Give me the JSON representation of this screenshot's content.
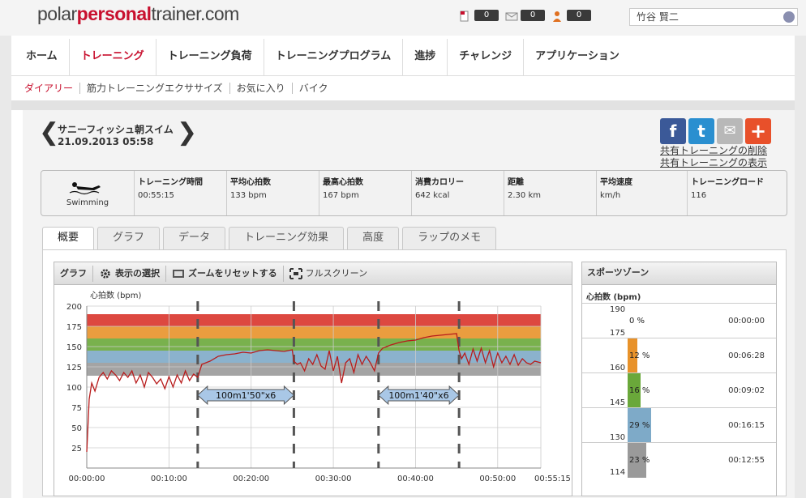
{
  "header": {
    "logo_prefix": "polar",
    "logo_red": "personal",
    "logo_suffix": "trainer.com",
    "counters": [
      {
        "icon": "document-icon",
        "value": "0"
      },
      {
        "icon": "mail-icon",
        "value": "0"
      },
      {
        "icon": "person-icon",
        "value": "0"
      }
    ],
    "user_name": "竹谷 賢二"
  },
  "main_nav": [
    {
      "label": "ホーム",
      "active": false
    },
    {
      "label": "トレーニング",
      "active": true
    },
    {
      "label": "トレーニング負荷",
      "active": false
    },
    {
      "label": "トレーニングプログラム",
      "active": false
    },
    {
      "label": "進捗",
      "active": false
    },
    {
      "label": "チャレンジ",
      "active": false
    },
    {
      "label": "アプリケーション",
      "active": false
    }
  ],
  "sub_nav": [
    {
      "label": "ダイアリー",
      "active": true
    },
    {
      "label": "筋力トレーニングエクササイズ",
      "active": false
    },
    {
      "label": "お気に入り",
      "active": false
    },
    {
      "label": "バイク",
      "active": false
    }
  ],
  "session": {
    "title": "サニーフィッシュ朝スイム",
    "datetime": "21.09.2013 05:58",
    "prev_icon": "chevron-left-icon",
    "next_icon": "chevron-right-icon"
  },
  "social": [
    {
      "icon": "facebook-icon",
      "glyph": "f",
      "color": "#3b5998"
    },
    {
      "icon": "twitter-icon",
      "glyph": "t",
      "color": "#2a8fd0"
    },
    {
      "icon": "mail-icon",
      "glyph": "✉",
      "color": "#b8b8b8"
    },
    {
      "icon": "plus-icon",
      "glyph": "+",
      "color": "#e8502a"
    }
  ],
  "share_links": [
    "共有トレーニングの削除",
    "共有トレーニングの表示"
  ],
  "stats": {
    "sport": "Swimming",
    "items": [
      {
        "label": "トレーニング時間",
        "value": "00:55:15"
      },
      {
        "label": "平均心拍数",
        "value": "133   bpm"
      },
      {
        "label": "最高心拍数",
        "value": "167   bpm"
      },
      {
        "label": "消費カロリー",
        "value": "642   kcal"
      },
      {
        "label": "距離",
        "value": "2.30   km"
      },
      {
        "label": "平均速度",
        "value": "km/h"
      },
      {
        "label": "トレーニングロード",
        "value": "116"
      }
    ]
  },
  "tabs": [
    {
      "label": "概要",
      "active": true
    },
    {
      "label": "グラフ",
      "active": false
    },
    {
      "label": "データ",
      "active": false
    },
    {
      "label": "トレーニング効果",
      "active": false
    },
    {
      "label": "高度",
      "active": false
    },
    {
      "label": "ラップのメモ",
      "active": false
    }
  ],
  "graph_toolbar": {
    "title": "グラフ",
    "select_label": "表示の選択",
    "reset_zoom_label": "ズームをリセットする",
    "fullscreen_label": "フルスクリーン"
  },
  "zones_panel": {
    "title": "スポーツゾーン",
    "unit_label": "心拍数 (bpm)",
    "zones": [
      {
        "upper": "190",
        "lower": "175",
        "percent": "0 %",
        "time": "00:00:00",
        "color": "#d9342b",
        "fraction": 0.0
      },
      {
        "upper": "",
        "lower": "160",
        "percent": "12 %",
        "time": "00:06:28",
        "color": "#e8922a",
        "fraction": 0.12
      },
      {
        "upper": "",
        "lower": "145",
        "percent": "16 %",
        "time": "00:09:02",
        "color": "#6aa83a",
        "fraction": 0.16
      },
      {
        "upper": "",
        "lower": "130",
        "percent": "29 %",
        "time": "00:16:15",
        "color": "#7eaac8",
        "fraction": 0.29
      },
      {
        "upper": "",
        "lower": "114",
        "percent": "23 %",
        "time": "00:12:55",
        "color": "#9a9a9a",
        "fraction": 0.23
      }
    ]
  },
  "chart_data": {
    "type": "line",
    "ylabel": "心拍数 (bpm)",
    "ylim": [
      0,
      200
    ],
    "yticks": [
      200,
      175,
      150,
      125,
      100,
      75,
      50,
      25
    ],
    "xticks": [
      "00:00:00",
      "00:10:00",
      "00:20:00",
      "00:30:00",
      "00:40:00",
      "00:50:00",
      "00:55:15"
    ],
    "xtick_minutes": [
      0,
      10,
      20,
      30,
      40,
      50,
      55.25
    ],
    "xlim_minutes": [
      0,
      55.25
    ],
    "grid": true,
    "zone_bands": [
      {
        "from": 175,
        "to": 190,
        "color": "#d9342b"
      },
      {
        "from": 160,
        "to": 175,
        "color": "#e8922a"
      },
      {
        "from": 145,
        "to": 160,
        "color": "#6aa83a"
      },
      {
        "from": 130,
        "to": 145,
        "color": "#7eaac8"
      },
      {
        "from": 114,
        "to": 130,
        "color": "#9a9a9a"
      }
    ],
    "interval_markers_minutes": [
      13.5,
      25.2,
      35.5,
      45.3
    ],
    "annotations": [
      {
        "text": "100m1'50\"x6",
        "from_min": 13.5,
        "to_min": 25.2,
        "y": 90
      },
      {
        "text": "100m1'40\"x6",
        "from_min": 35.5,
        "to_min": 45.3,
        "y": 90
      }
    ],
    "series": [
      {
        "color": "#b81c1c",
        "x": [
          0,
          0.3,
          0.6,
          1,
          1.5,
          2,
          2.5,
          3,
          3.5,
          4,
          4.5,
          5,
          5.5,
          6,
          6.5,
          7,
          7.5,
          8,
          8.5,
          9,
          9.5,
          10,
          10.5,
          11,
          11.5,
          12,
          12.5,
          13,
          13.5,
          14,
          15,
          16,
          17,
          18,
          19,
          20,
          21,
          22,
          23,
          24,
          25,
          25.2,
          25.6,
          26,
          26.5,
          27,
          27.5,
          28,
          28.5,
          29,
          29.5,
          30,
          30.5,
          31,
          31.5,
          32,
          32.5,
          33,
          33.5,
          34,
          34.5,
          35,
          35.5,
          36,
          37,
          38,
          39,
          40,
          41,
          42,
          43,
          44,
          45,
          45.3,
          45.6,
          46,
          46.5,
          47,
          47.5,
          48,
          48.5,
          49,
          49.5,
          50,
          50.5,
          51,
          51.5,
          52,
          52.5,
          53,
          53.5,
          54,
          54.5,
          55.25
        ],
        "values": [
          20,
          85,
          105,
          95,
          112,
          118,
          110,
          120,
          115,
          108,
          118,
          112,
          120,
          105,
          115,
          100,
          118,
          112,
          104,
          110,
          98,
          113,
          100,
          115,
          105,
          120,
          108,
          116,
          112,
          128,
          132,
          138,
          140,
          141,
          143,
          142,
          145,
          146,
          145,
          144,
          146,
          132,
          128,
          130,
          120,
          135,
          128,
          140,
          126,
          122,
          145,
          120,
          138,
          105,
          130,
          135,
          118,
          140,
          128,
          138,
          130,
          120,
          142,
          148,
          152,
          155,
          157,
          158,
          161,
          163,
          164,
          165,
          166,
          145,
          135,
          142,
          128,
          147,
          132,
          148,
          130,
          145,
          125,
          142,
          130,
          138,
          128,
          140,
          127,
          135,
          130,
          128,
          132,
          130
        ]
      }
    ]
  }
}
